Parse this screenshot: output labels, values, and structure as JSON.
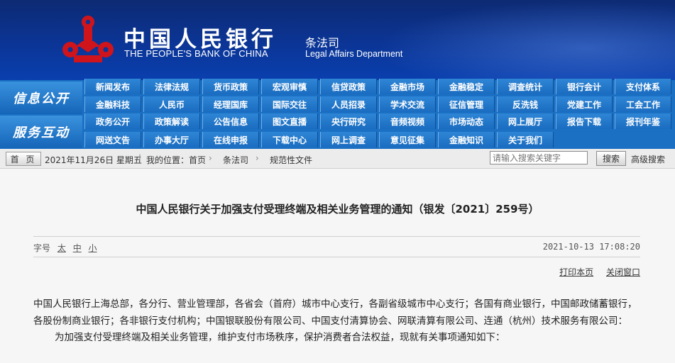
{
  "header": {
    "bank_name_cn": "中国人民银行",
    "bank_name_en": "THE PEOPLE'S BANK OF CHINA",
    "dept_cn": "条法司",
    "dept_en": "Legal Affairs Department",
    "colors": {
      "header_bg": "#0b3596",
      "emblem": "#d0141b"
    }
  },
  "nav": {
    "info_label": "信息公开",
    "service_label": "服务互动",
    "info_row1": [
      "新闻发布",
      "法律法规",
      "货币政策",
      "宏观审慎",
      "信贷政策",
      "金融市场",
      "金融稳定",
      "调查统计",
      "银行会计",
      "支付体系"
    ],
    "info_row2": [
      "金融科技",
      "人民币",
      "经理国库",
      "国际交往",
      "人员招录",
      "学术交流",
      "征信管理",
      "反洗钱",
      "党建工作",
      "工会工作"
    ],
    "service_row1": [
      "政务公开",
      "政策解读",
      "公告信息",
      "图文直播",
      "央行研究",
      "音频视频",
      "市场动态",
      "网上展厅",
      "报告下载",
      "报刊年鉴"
    ],
    "service_row2": [
      "网送文告",
      "办事大厅",
      "在线申报",
      "下载中心",
      "网上调查",
      "意见征集",
      "金融知识",
      "关于我们"
    ]
  },
  "crumbs": {
    "home": "首 页",
    "date": "2021年11月26日  星期五",
    "location": "我的位置：首页",
    "level1": "条法司",
    "level2": "规范性文件",
    "search_placeholder": "请输入搜索关键字",
    "search_button": "搜索",
    "advanced": "高级搜索"
  },
  "article": {
    "title": "中国人民银行关于加强支付受理终端及相关业务管理的通知（银发〔2021〕259号）",
    "font_label": "字号",
    "font_large": "太",
    "font_medium": "中",
    "font_small": "小",
    "publish_time": "2021-10-13 17:08:20",
    "print": "打印本页",
    "close": "关闭窗口",
    "recipients": "中国人民银行上海总部，各分行、营业管理部，各省会（首府）城市中心支行，各副省级城市中心支行；各国有商业银行，中国邮政储蓄银行，各股份制商业银行；各非银行支付机构；中国银联股份有限公司、中国支付清算协会、网联清算有限公司、连通（杭州）技术服务有限公司：",
    "intro": "为加强支付受理终端及相关业务管理，维护支付市场秩序，保护消费者合法权益，现就有关事项通知如下："
  }
}
